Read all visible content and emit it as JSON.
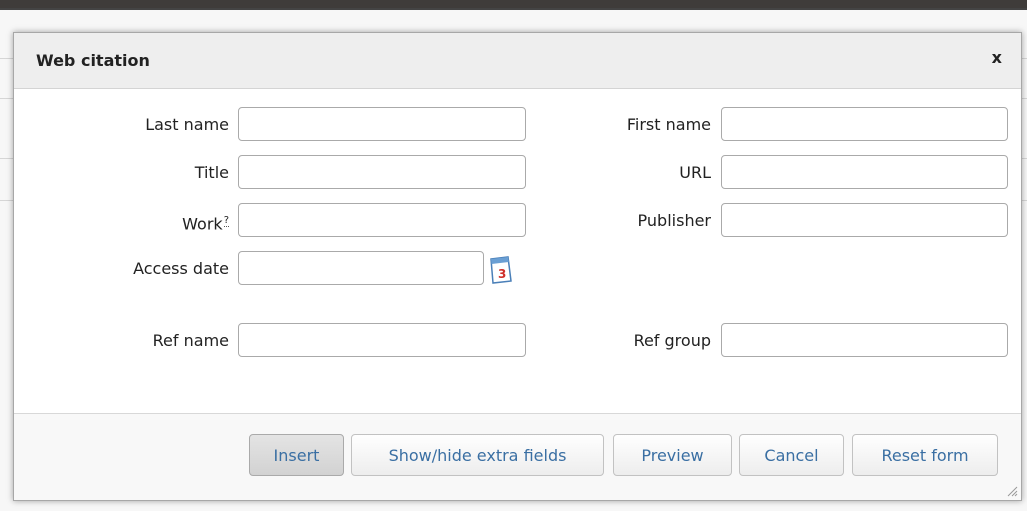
{
  "dialog": {
    "title": "Web citation",
    "close_label": "x"
  },
  "fields": {
    "last_name": {
      "label": "Last name",
      "value": ""
    },
    "first_name": {
      "label": "First name",
      "value": ""
    },
    "title": {
      "label": "Title",
      "value": ""
    },
    "url": {
      "label": "URL",
      "value": ""
    },
    "work": {
      "label": "Work",
      "help": "?",
      "value": ""
    },
    "publisher": {
      "label": "Publisher",
      "value": ""
    },
    "access_date": {
      "label": "Access date",
      "value": "",
      "calendar_icon": "calendar-icon",
      "calendar_day": "3"
    },
    "ref_name": {
      "label": "Ref name",
      "value": ""
    },
    "ref_group": {
      "label": "Ref group",
      "value": ""
    }
  },
  "buttons": {
    "insert": "Insert",
    "show_hide": "Show/hide extra fields",
    "preview": "Preview",
    "cancel": "Cancel",
    "reset": "Reset form"
  },
  "colors": {
    "button_text": "#3a6fa3",
    "titlebar_bg": "#eeeeee",
    "backdrop": "#3f3c3a"
  }
}
